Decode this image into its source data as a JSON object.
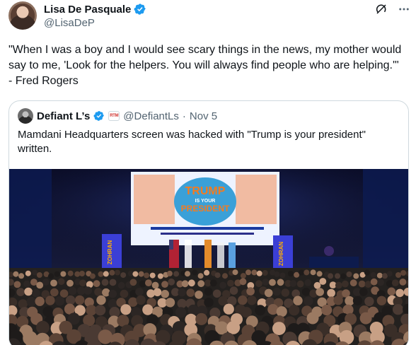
{
  "author": {
    "display_name": "Lisa De Pasquale",
    "handle": "@LisaDeP",
    "verified": true
  },
  "tweet": {
    "text": "\"When I was a boy and I would see scary things in the news, my mother would say to me, 'Look for the helpers. You will always find people who are helping.'\" - Fred Rogers"
  },
  "quoted": {
    "display_name": "Defiant L’s",
    "verified": true,
    "affiliate_badge": "RTM",
    "handle": "@DefiantLs",
    "separator": "·",
    "date": "Nov 5",
    "text": "Mamdani Headquarters screen was hacked with \"Trump is your president\" written.",
    "media": {
      "screen_line1": "TRUMP",
      "screen_line2": "IS YOUR",
      "screen_line3": "PRESIDENT",
      "banner_text": "ZOHRAN"
    }
  },
  "icons": {
    "verified": "verified-badge-icon",
    "grok": "grok-icon",
    "more": "more-options-icon"
  },
  "colors": {
    "verified_blue": "#1d9bf0",
    "text": "#0f1419",
    "secondary": "#536471",
    "border": "#cfd9de"
  }
}
